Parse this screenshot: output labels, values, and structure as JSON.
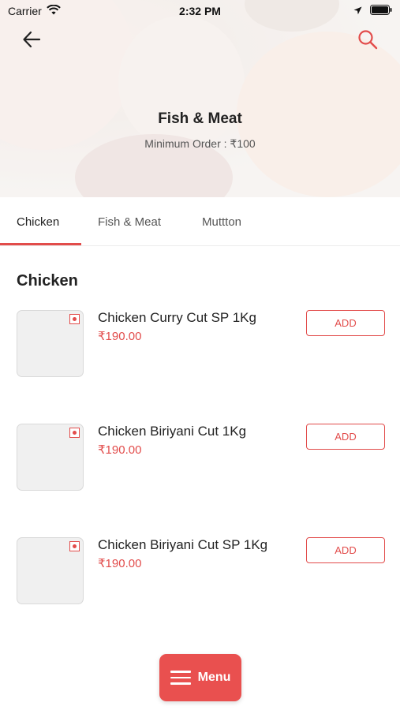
{
  "status_bar": {
    "carrier": "Carrier",
    "time": "2:32 PM"
  },
  "header": {
    "title": "Fish & Meat",
    "min_order": "Minimum Order : ₹100"
  },
  "tabs": [
    {
      "label": "Chicken",
      "active": true
    },
    {
      "label": "Fish & Meat",
      "active": false
    },
    {
      "label": "Muttton",
      "active": false
    }
  ],
  "section": {
    "title": "Chicken"
  },
  "items": [
    {
      "name": "Chicken Curry Cut SP 1Kg",
      "price": "₹190.00",
      "add_label": "ADD"
    },
    {
      "name": "Chicken Biriyani Cut 1Kg",
      "price": "₹190.00",
      "add_label": "ADD"
    },
    {
      "name": "Chicken Biriyani Cut SP 1Kg",
      "price": "₹190.00",
      "add_label": "ADD"
    }
  ],
  "menu_button": {
    "label": "Menu"
  },
  "colors": {
    "accent": "#e24c4b",
    "fab": "#e9504f"
  },
  "icons": {
    "back": "arrow-left-icon",
    "search": "search-icon",
    "menu": "hamburger-icon",
    "wifi": "wifi-icon",
    "location": "location-arrow-icon",
    "battery": "battery-icon",
    "veg": "veg-mark-icon"
  }
}
